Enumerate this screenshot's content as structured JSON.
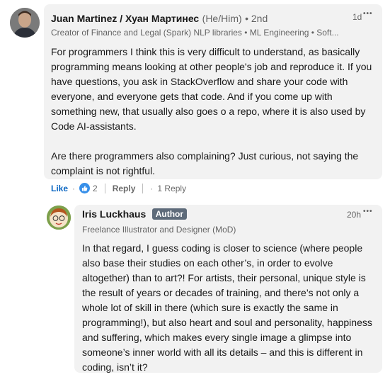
{
  "comment1": {
    "author": "Juan Martinez / Хуан Мартинес",
    "pronouns": "(He/Him)",
    "degree": "• 2nd",
    "headline": "Creator of Finance and Legal (Spark) NLP libraries • ML Engineering • Soft...",
    "time": "1d",
    "more": "•••",
    "paragraph1": "For programmers I think this is very difficult to understand, as basically programming means looking at other people's job and reproduce it. If you have questions, you ask in StackOverflow and share your code with everyone, and everyone gets that code. And if you come up with something new, that usually also goes o a repo, where it is also used by Code AI-assistants.",
    "paragraph2": "Are there programmers also complaining? Just curious, not saying the complaint is not rightful.",
    "like_label": "Like",
    "dot": "·",
    "reaction_count": "2",
    "reply_label": "Reply",
    "replies_label": "1 Reply"
  },
  "comment2": {
    "author": "Iris Luckhaus",
    "badge": "Author",
    "headline": "Freelance Illustrator and Designer (MoD)",
    "time": "20h",
    "more": "•••",
    "text": "In that regard, I guess coding is closer to science (where people also base their studies on each other’s, in order to evolve altogether) than to art?! For artists, their personal, unique style is the result of years or decades of training, and there’s not only a whole lot of skill in there (which sure is exactly the same in programming!), but also heart and soul and personality, happiness and suffering, which makes every single image a glimpse into someone’s inner world with all its details – and this is different in coding, isn’t it?"
  },
  "icons": {
    "reaction": "thumbs-up-icon",
    "more": "ellipsis-icon"
  },
  "colors": {
    "link_blue": "#0a66c2",
    "bubble_bg": "#f2f2f2",
    "badge_bg": "#5e6b7a"
  }
}
